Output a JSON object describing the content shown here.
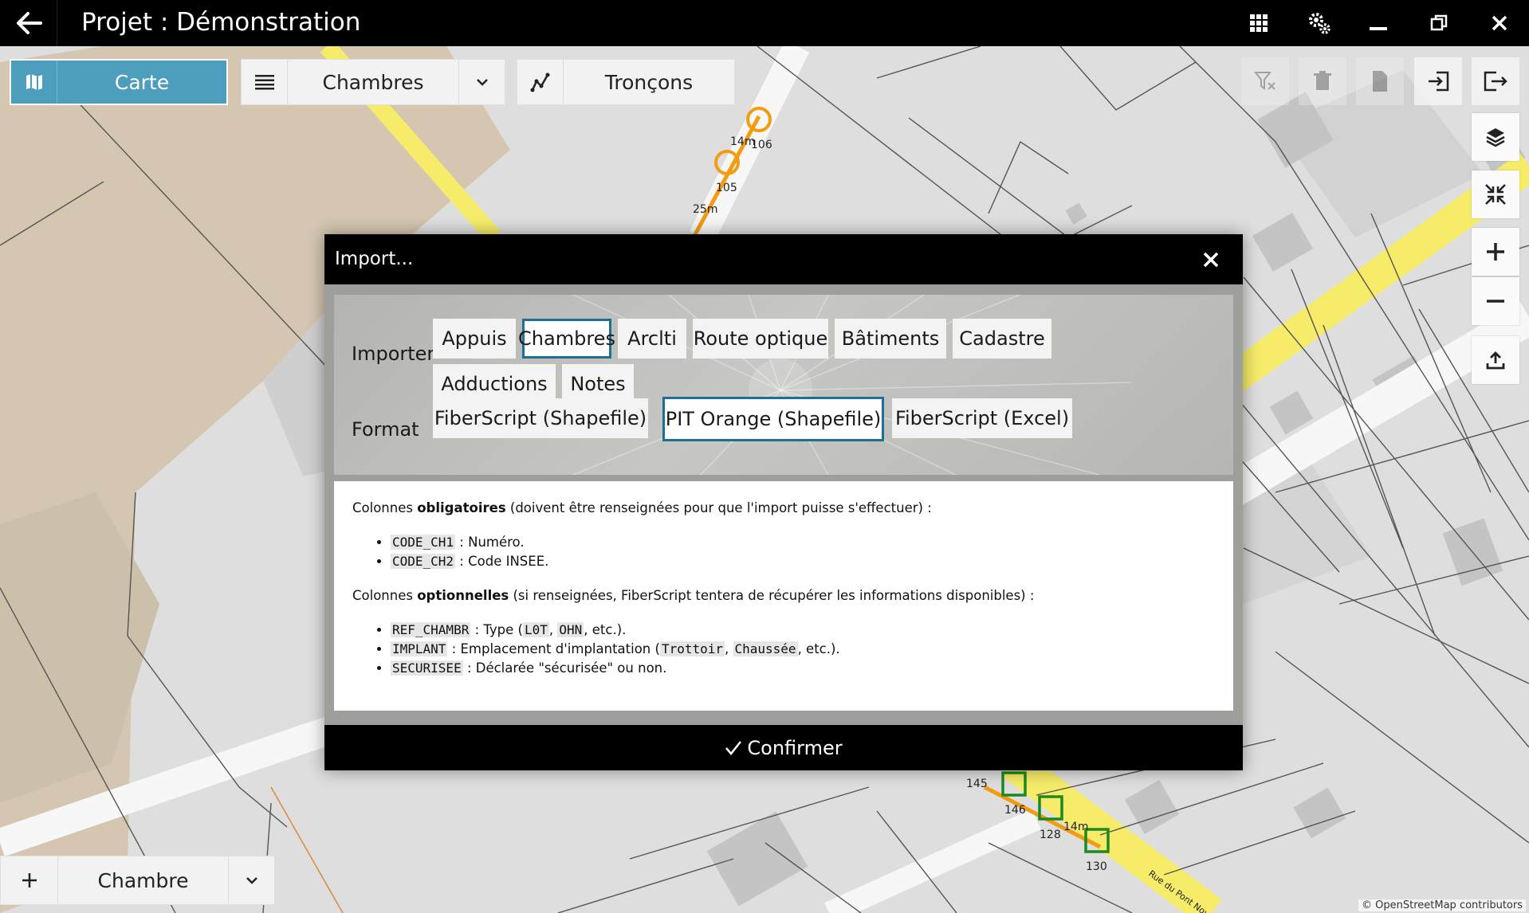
{
  "titlebar": {
    "title": "Projet : Démonstration"
  },
  "toolbar": {
    "carte_label": "Carte",
    "layer_label": "Chambres",
    "troncons_label": "Tronçons"
  },
  "map": {
    "attribution": "© OpenStreetMap contributors",
    "labels": {
      "l1": "14m",
      "l2": "106",
      "l3": "105",
      "l4": "25m",
      "l5": "145",
      "l6": "146",
      "l7": "128",
      "l8": "14m",
      "l9": "130",
      "street": "Rue du Pont Noyer"
    }
  },
  "bottom": {
    "add_label": "Chambre"
  },
  "modal": {
    "title": "Import...",
    "importer_label": "Importer",
    "format_label": "Format",
    "importer_options": [
      "Appuis",
      "Chambres",
      "Arclti",
      "Route optique",
      "Bâtiments",
      "Cadastre",
      "Adductions",
      "Notes"
    ],
    "importer_selected": "Chambres",
    "format_options": [
      "FiberScript (Shapefile)",
      "PIT Orange (Shapefile)",
      "FiberScript (Excel)"
    ],
    "format_selected": "PIT Orange (Shapefile)",
    "info": {
      "mandatory_prefix": "Colonnes ",
      "mandatory_bold": "obligatoires",
      "mandatory_suffix": " (doivent être renseignées pour que l'import puisse s'effectuer) :",
      "mandatory_items": [
        {
          "code": "CODE_CH1",
          "text": " : Numéro."
        },
        {
          "code": "CODE_CH2",
          "text": " : Code INSEE."
        }
      ],
      "optional_prefix": "Colonnes ",
      "optional_bold": "optionnelles",
      "optional_suffix": " (si renseignées, FiberScript tentera de récupérer les informations disponibles) :",
      "opt1_code": "REF_CHAMBR",
      "opt1_a": " : Type (",
      "opt1_c1": "L0T",
      "opt1_sep": ", ",
      "opt1_c2": "OHN",
      "opt1_end": ", etc.).",
      "opt2_code": "IMPLANT",
      "opt2_a": " : Emplacement d'implantation (",
      "opt2_c1": "Trottoir",
      "opt2_sep": ", ",
      "opt2_c2": "Chaussée",
      "opt2_end": ", etc.).",
      "opt3_code": "SECURISEE",
      "opt3_a": " : Déclarée \"sécurisée\" ou non."
    },
    "confirm_label": "Confirmer"
  },
  "colors": {
    "accent": "#4d9dbd",
    "selected_border": "#1d6f99",
    "road_yellow": "#f6ec6a",
    "cable_orange": "#f39c12",
    "chamber_green": "#1e8a1e"
  },
  "icons": [
    "back-arrow-icon",
    "apps-grid-icon",
    "settings-gears-icon",
    "minimize-icon",
    "restore-icon",
    "close-icon",
    "map-icon",
    "list-icon",
    "chevron-down-icon",
    "route-icon",
    "filter-clear-icon",
    "trash-icon",
    "file-icon",
    "import-icon",
    "export-icon",
    "layers-icon",
    "collapse-icon",
    "zoom-in-icon",
    "zoom-out-icon",
    "upload-icon",
    "plus-icon",
    "check-icon"
  ]
}
